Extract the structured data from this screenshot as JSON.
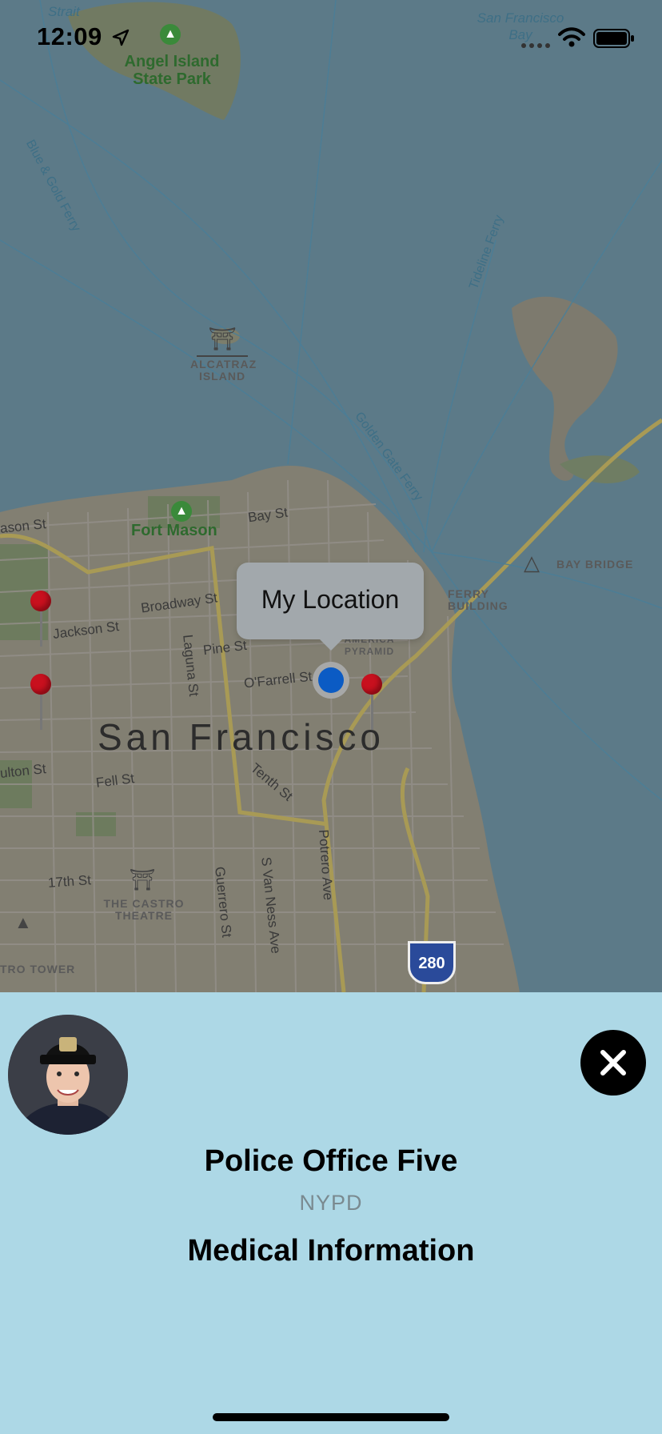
{
  "status_bar": {
    "time": "12:09"
  },
  "map": {
    "city_label": "San Francisco",
    "water_labels": [
      "Strait",
      "San Francisco Bay"
    ],
    "park_labels": [
      "Angel Island State Park",
      "Fort Mason"
    ],
    "poi_labels": [
      "ALCATRAZ ISLAND",
      "FERRY BUILDING",
      "BAY BRIDGE",
      "THE CASTRO THEATRE",
      "TRO TOWER",
      "AMERICA PYRAMID"
    ],
    "ferry_labels": [
      "Blue & Gold Ferry",
      "Tideline Ferry",
      "Golden Gate Ferry"
    ],
    "streets": [
      "Bay St",
      "ason St",
      "Broadway St",
      "Jackson St",
      "Pine St",
      "O'Farrell St",
      "Laguna St",
      "Tenth St",
      "Fell St",
      "ulton St",
      "17th St",
      "Guerrero St",
      "S Van Ness Ave",
      "Potrero Ave"
    ],
    "highway_shield": "280",
    "callout_label": "My Location"
  },
  "panel": {
    "officer_name": "Police Office Five",
    "department": "NYPD",
    "section_title": "Medical Information"
  },
  "colors": {
    "panel_bg": "#add8e6",
    "pin": "#c8101e",
    "location_dot": "#0b5bc4"
  }
}
